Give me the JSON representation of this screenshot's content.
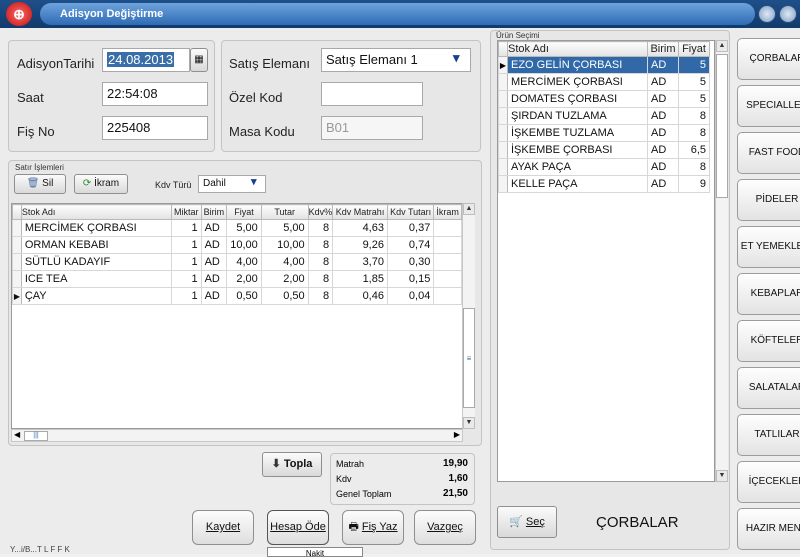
{
  "window": {
    "title": "Adisyon Değiştirme"
  },
  "header_form": {
    "date_label": "AdisyonTarihi",
    "date_value": "24.08.2013",
    "time_label": "Saat",
    "time_value": "22:54:08",
    "receipt_label": "Fiş No",
    "receipt_value": "225408",
    "seller_label": "Satış Elemanı",
    "seller_value": "Satış Elemanı 1",
    "special_code_label": "Özel Kod",
    "special_code_value": "",
    "table_code_label": "Masa Kodu",
    "table_code_value": "B01"
  },
  "line_ops": {
    "group_label": "Satır İşlemleri",
    "delete_label": "Sil",
    "treat_label": "İkram",
    "vat_type_label": "Kdv Türü",
    "vat_type_value": "Dahil"
  },
  "order_grid": {
    "columns": [
      "Stok Adı",
      "Miktar",
      "Birim",
      "Fiyat",
      "Tutar",
      "Kdv%",
      "Kdv Matrahı",
      "Kdv Tutarı",
      "İkram"
    ],
    "rows": [
      [
        "MERCİMEK ÇORBASI",
        "1",
        "AD",
        "5,00",
        "5,00",
        "8",
        "4,63",
        "0,37",
        ""
      ],
      [
        "ORMAN KEBABI",
        "1",
        "AD",
        "10,00",
        "10,00",
        "8",
        "9,26",
        "0,74",
        ""
      ],
      [
        "SÜTLÜ KADAYIF",
        "1",
        "AD",
        "4,00",
        "4,00",
        "8",
        "3,70",
        "0,30",
        ""
      ],
      [
        "ICE TEA",
        "1",
        "AD",
        "2,00",
        "2,00",
        "8",
        "1,85",
        "0,15",
        ""
      ],
      [
        "ÇAY",
        "1",
        "AD",
        "0,50",
        "0,50",
        "8",
        "0,46",
        "0,04",
        ""
      ]
    ],
    "current_row": 4
  },
  "totals": {
    "sum_button": "Topla",
    "base_label": "Matrah",
    "base_value": "19,90",
    "vat_label": "Kdv",
    "vat_value": "1,60",
    "grand_label": "Genel Toplam",
    "grand_value": "21,50"
  },
  "bottom_buttons": {
    "save": "Kaydet",
    "close_bill": "Hesap Öde",
    "print": "Fiş Yaz",
    "cancel": "Vazgeç",
    "popup_partial": "Nakit",
    "status_partial": "Y...i/B...T L F F K"
  },
  "product_selection": {
    "group_label": "Ürün Seçimi",
    "columns": [
      "Stok Adı",
      "Birim",
      "Fiyat"
    ],
    "rows": [
      [
        "EZO GELİN ÇORBASI",
        "AD",
        "5"
      ],
      [
        "MERCİMEK ÇORBASI",
        "AD",
        "5"
      ],
      [
        "DOMATES ÇORBASI",
        "AD",
        "5"
      ],
      [
        "ŞIRDAN TUZLAMA",
        "AD",
        "8"
      ],
      [
        "İŞKEMBE TUZLAMA",
        "AD",
        "8"
      ],
      [
        "İŞKEMBE ÇORBASI",
        "AD",
        "6,5"
      ],
      [
        "AYAK PAÇA",
        "AD",
        "8"
      ],
      [
        "KELLE PAÇA",
        "AD",
        "9"
      ]
    ],
    "selected_row": 0,
    "select_button": "Seç",
    "current_category": "ÇORBALAR"
  },
  "categories": [
    "ÇORBALAR",
    "SPECIALLER",
    "FAST FOOD",
    "PİDELER",
    "ET YEMEKLERİ",
    "KEBAPLAR",
    "KÖFTELER",
    "SALATALAR",
    "TATLILAR",
    "İÇECEKLER",
    "HAZIR MENÜ"
  ],
  "colors": {
    "title_bar": "#2f6bb5",
    "selection": "#3169a8"
  }
}
